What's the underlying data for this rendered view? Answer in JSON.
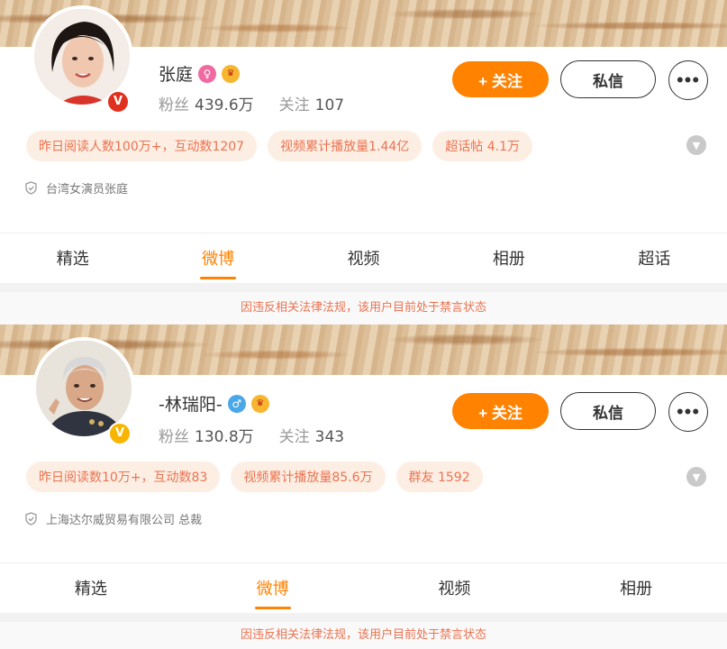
{
  "profiles": [
    {
      "name": "张庭",
      "gender_icon": "female-icon",
      "badge": "V",
      "fans_label": "粉丝",
      "fans_value": "439.6万",
      "follow_label": "关注",
      "follow_value": "107",
      "follow_button": "+ 关注",
      "message_button": "私信",
      "more_button": "•••",
      "tags": [
        "昨日阅读人数100万+，互动数1207",
        "视频累计播放量1.44亿",
        "超话帖 4.1万"
      ],
      "description": "台湾女演员张庭",
      "tabs": [
        "精选",
        "微博",
        "视频",
        "相册",
        "超话"
      ],
      "active_tab": "微博",
      "notice": "因违反相关法律法规，该用户目前处于禁言状态"
    },
    {
      "name": "-林瑞阳-",
      "gender_icon": "male-icon",
      "badge": "V",
      "fans_label": "粉丝",
      "fans_value": "130.8万",
      "follow_label": "关注",
      "follow_value": "343",
      "follow_button": "+ 关注",
      "message_button": "私信",
      "more_button": "•••",
      "tags": [
        "昨日阅读数10万+，互动数83",
        "视频累计播放量85.6万",
        "群友 1592"
      ],
      "description": "上海达尔威贸易有限公司 总裁",
      "tabs": [
        "精选",
        "微博",
        "视频",
        "相册"
      ],
      "active_tab": "微博",
      "notice": "因违反相关法律法规，该用户目前处于禁言状态"
    }
  ],
  "colors": {
    "accent": "#ff8200",
    "tag_text": "#eb7350",
    "tag_bg": "#fdeee3"
  }
}
